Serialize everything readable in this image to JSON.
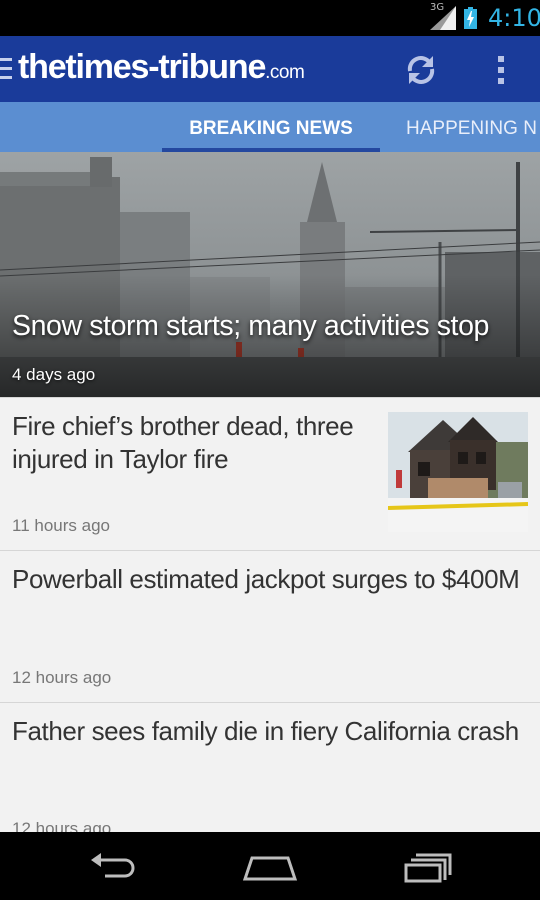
{
  "status_bar": {
    "network": "3G",
    "time": "4:10",
    "icons": [
      "signal-icon",
      "battery-charging-icon"
    ]
  },
  "action_bar": {
    "logo_main": "thetimes-tribune",
    "logo_suffix": ".com",
    "icons": [
      "menu-icon",
      "refresh-icon",
      "overflow-menu-icon"
    ],
    "colors": {
      "background": "#1a3b9a",
      "tab_bar": "#5b8ed1"
    }
  },
  "tabs": [
    {
      "label": "BREAKING NEWS",
      "active": true
    },
    {
      "label": "HAPPENING N",
      "active": false
    }
  ],
  "hero": {
    "headline": "Snow storm starts; many activities stop",
    "time": "4 days ago"
  },
  "stories": [
    {
      "title": "Fire chief’s brother dead, three injured in Taylor fire",
      "time": "11 hours ago",
      "has_thumbnail": true
    },
    {
      "title": "Powerball estimated jackpot surges to $400M",
      "time": "12 hours ago",
      "has_thumbnail": false
    },
    {
      "title": "Father sees family die in fiery California crash",
      "time": "12 hours ago",
      "has_thumbnail": false
    }
  ],
  "nav_bar": {
    "icons": [
      "back-icon",
      "home-icon",
      "recent-apps-icon"
    ]
  }
}
